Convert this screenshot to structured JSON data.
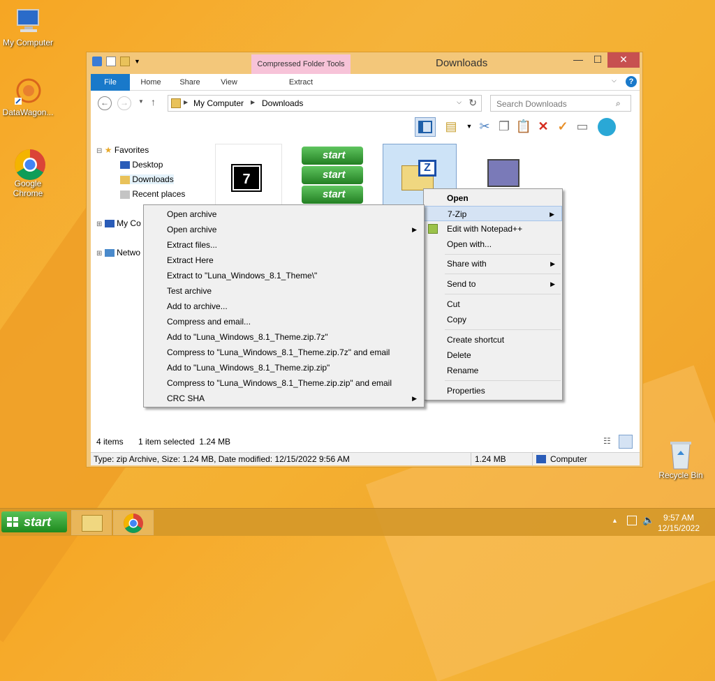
{
  "desktop": {
    "icons": [
      {
        "label": "My Computer",
        "icon": "computer-icon"
      },
      {
        "label": "DataWagon...",
        "icon": "datawagon-icon"
      },
      {
        "label": "Google Chrome",
        "icon": "chrome-icon"
      },
      {
        "label": "Recycle Bin",
        "icon": "recycle-bin-icon"
      }
    ]
  },
  "window": {
    "title": "Downloads",
    "contextual_tab_group": "Compressed Folder Tools",
    "tabs": [
      "File",
      "Home",
      "Share",
      "View",
      "Extract"
    ],
    "address": {
      "parts": [
        "My Computer",
        "Downloads"
      ]
    },
    "search_placeholder": "Search Downloads"
  },
  "nav": {
    "favorites": "Favorites",
    "items": [
      "Desktop",
      "Downloads",
      "Recent places"
    ],
    "my_computer": "My Co",
    "network": "Netwo"
  },
  "status": {
    "items_count": "4 items",
    "selected": "1 item selected  1.24 MB"
  },
  "details": {
    "info": "Type: zip Archive, Size: 1.24 MB, Date modified: 12/15/2022 9:56 AM",
    "size": "1.24 MB",
    "location": "Computer"
  },
  "context_menu": {
    "items": [
      "Open",
      "7-Zip",
      "Edit with Notepad++",
      "Open with...",
      "Share with",
      "Send to",
      "Cut",
      "Copy",
      "Create shortcut",
      "Delete",
      "Rename",
      "Properties"
    ]
  },
  "submenu": {
    "items": [
      "Open archive",
      "Open archive",
      "Extract files...",
      "Extract Here",
      "Extract to \"Luna_Windows_8.1_Theme\\\"",
      "Test archive",
      "Add to archive...",
      "Compress and email...",
      "Add to \"Luna_Windows_8.1_Theme.zip.7z\"",
      "Compress to \"Luna_Windows_8.1_Theme.zip.7z\" and email",
      "Add to \"Luna_Windows_8.1_Theme.zip.zip\"",
      "Compress to \"Luna_Windows_8.1_Theme.zip.zip\" and email",
      "CRC SHA"
    ]
  },
  "taskbar": {
    "start_label": "start",
    "time": "9:57 AM",
    "date": "12/15/2022"
  },
  "tiles": {
    "start_label": "start",
    "archive_letter": "Z"
  }
}
